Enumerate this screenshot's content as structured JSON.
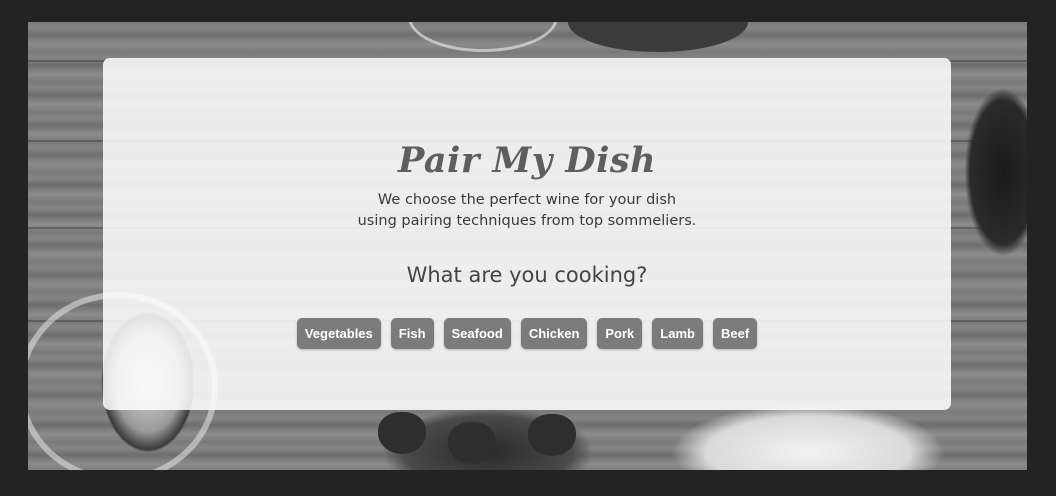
{
  "brand": {
    "title": "Pair My Dish"
  },
  "tagline": {
    "line1": "We choose the perfect wine for your dish",
    "line2": "using pairing techniques from top sommeliers."
  },
  "prompt": {
    "question": "What are you cooking?"
  },
  "choices": [
    {
      "label": "Vegetables"
    },
    {
      "label": "Fish"
    },
    {
      "label": "Seafood"
    },
    {
      "label": "Chicken"
    },
    {
      "label": "Pork"
    },
    {
      "label": "Lamb"
    },
    {
      "label": "Beef"
    }
  ],
  "colors": {
    "button_bg": "#7b7b7b",
    "button_text": "#ffffff",
    "title": "#5e5e5e"
  }
}
